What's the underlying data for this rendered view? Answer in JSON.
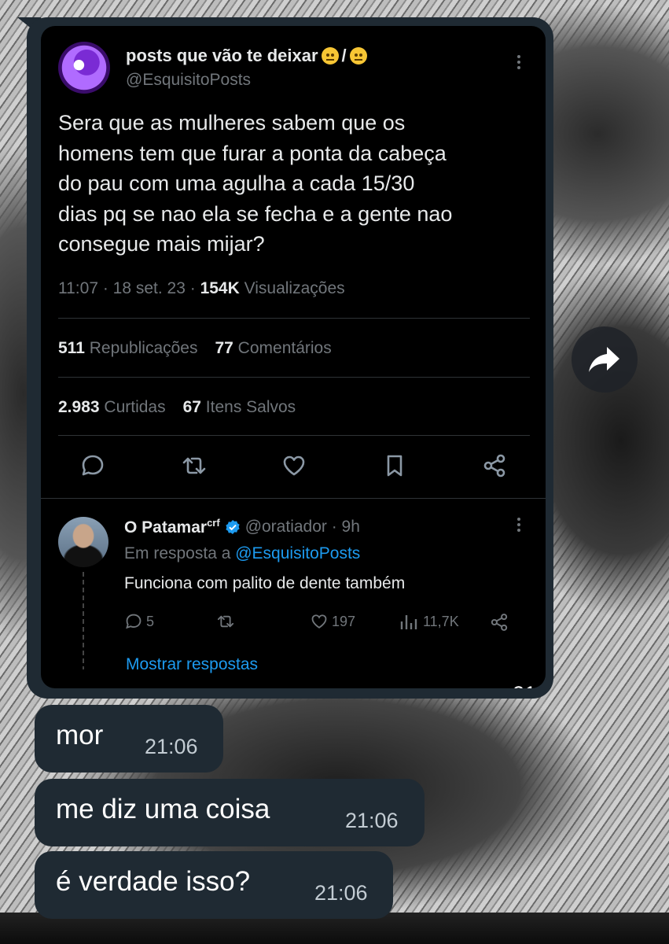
{
  "tweet": {
    "author_name": "posts que vão te deixar",
    "author_name_separator": "/",
    "author_handle": "@EsquisitoPosts",
    "text_lines": [
      "Sera que as mulheres sabem que os",
      "homens tem que furar a ponta da cabeça",
      "do pau com uma agulha a cada 15/30",
      "dias pq se nao ela se fecha e a gente nao",
      "consegue mais mijar?"
    ],
    "meta_time": "11:07 · 18 set. 23 · ",
    "meta_views_count": "154K",
    "meta_views_label": " Visualizações",
    "reposts_count": "511",
    "reposts_label": " Republicações",
    "comments_count": "77",
    "comments_label": " Comentários",
    "likes_count": "2.983",
    "likes_label": " Curtidas",
    "saves_count": "67",
    "saves_label": " Itens Salvos"
  },
  "reply": {
    "name": "O Patamar",
    "name_suffix": "crf",
    "handle_time": "@oratiador · 9h",
    "context_prefix": "Em resposta a ",
    "context_link": "@EsquisitoPosts",
    "text": "Funciona com palito de dente também",
    "reply_count": "5",
    "like_count": "197",
    "views_count": "11,7K",
    "show_replies": "Mostrar respostas"
  },
  "media_message_time": "21:06",
  "messages": [
    {
      "text": "mor",
      "time": "21:06"
    },
    {
      "text": "me diz uma coisa",
      "time": "21:06"
    },
    {
      "text": "é verdade isso?",
      "time": "21:06"
    }
  ],
  "colors": {
    "bubble": "#1f2a33",
    "tweet_bg": "#000000",
    "link_blue": "#1d9bf0",
    "muted_text": "#71767b"
  },
  "icons": [
    "forward-icon",
    "more-icon",
    "reply-icon",
    "repost-icon",
    "like-icon",
    "bookmark-icon",
    "share-icon",
    "verified-icon",
    "views-icon"
  ]
}
